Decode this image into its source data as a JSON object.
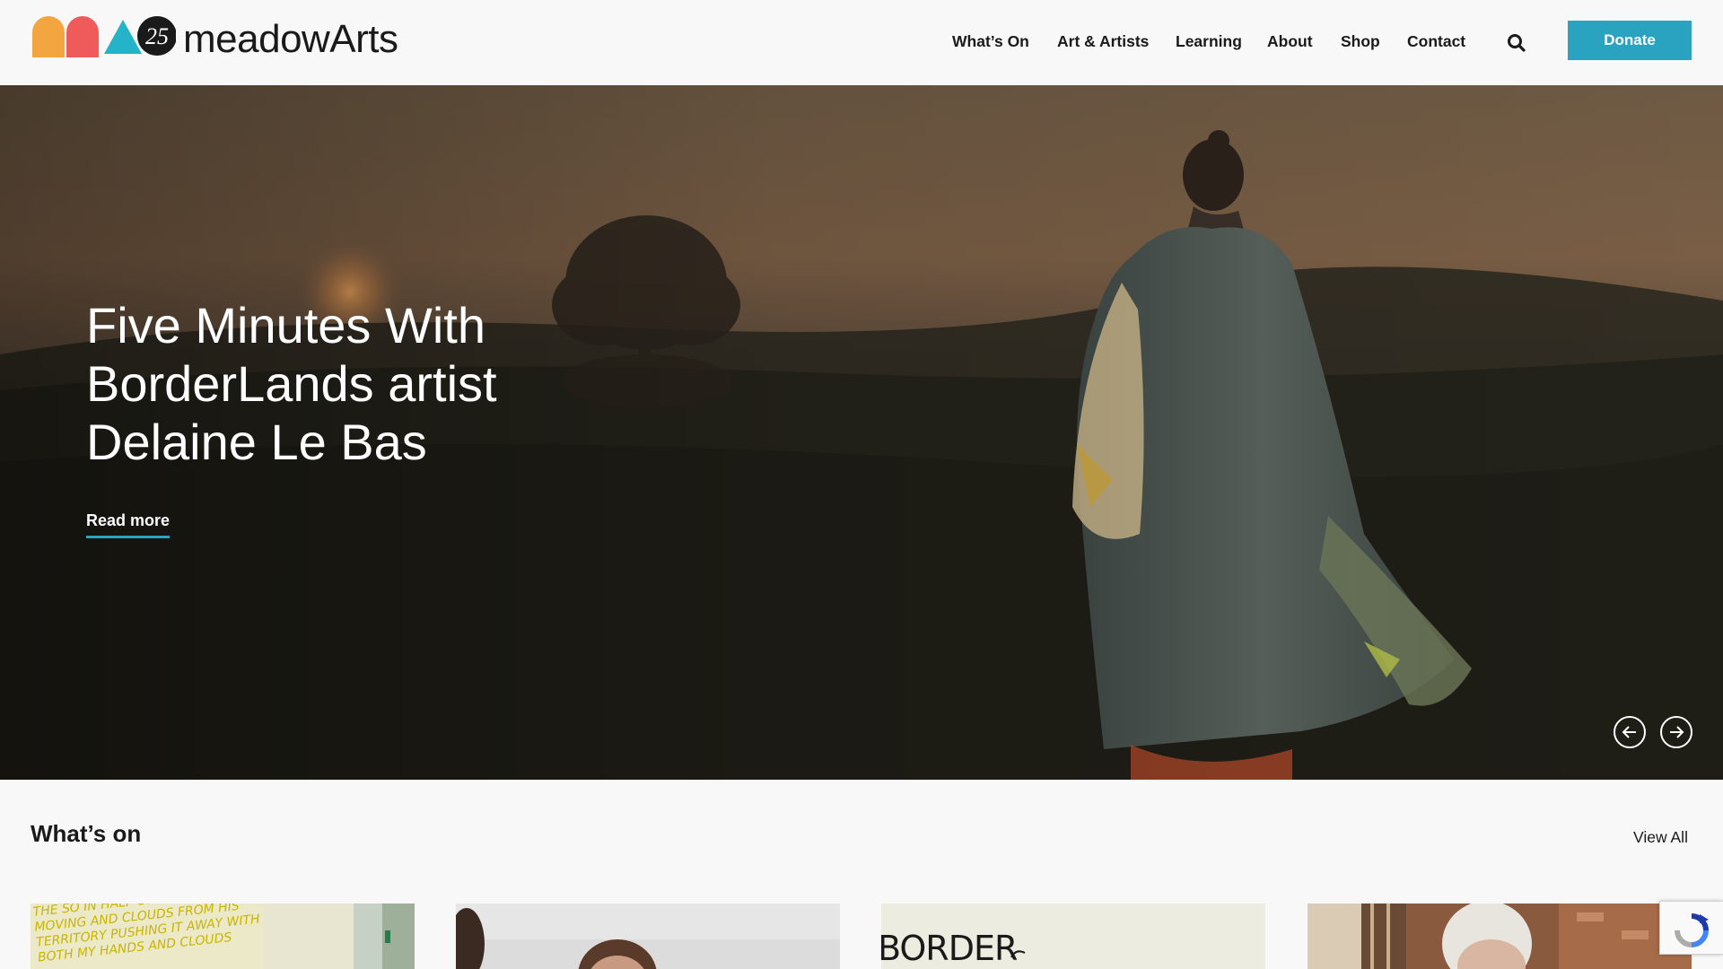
{
  "brand": {
    "logo_badge": "25",
    "wordmark": "meadowArts"
  },
  "nav": {
    "items": [
      {
        "label": "What’s On"
      },
      {
        "label": "Art & Artists"
      },
      {
        "label": "Learning"
      },
      {
        "label": "About"
      },
      {
        "label": "Shop"
      },
      {
        "label": "Contact"
      }
    ],
    "search_icon": "search-icon",
    "donate_label": "Donate"
  },
  "hero": {
    "title": "Five Minutes With BorderLands artist Delaine Le Bas",
    "cta_label": "Read more",
    "prev_icon": "arrow-left-circle-icon",
    "next_icon": "arrow-right-circle-icon"
  },
  "whats_on": {
    "title": "What’s on",
    "view_all_label": "View All",
    "cards": [
      {
        "image_text": "THE SO IN HALF ONE FOR THE BIRDS MOVING AND CLOUDS FROM HIS TERRITORY PUSHING IT AWAY WITH BOTH MY HANDS AND CLOUDS"
      },
      {
        "image_text": ""
      },
      {
        "image_text": "BORDER"
      },
      {
        "image_text": ""
      }
    ]
  },
  "colors": {
    "accent": "#2aa3c0",
    "logo_orange": "#f3a640",
    "logo_red": "#ef5b5b",
    "logo_teal": "#24b3c9"
  },
  "widgets": {
    "recaptcha_icon": "recaptcha-icon"
  }
}
